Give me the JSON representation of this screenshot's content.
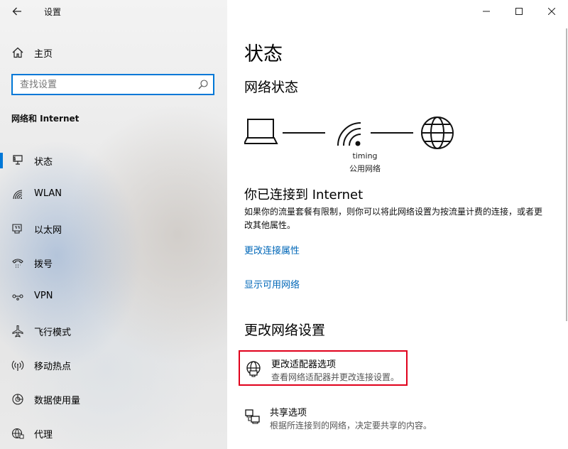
{
  "window": {
    "app_title": "设置",
    "controls": {
      "minimize": "minimize-icon",
      "maximize": "maximize-icon",
      "close": "close-icon"
    }
  },
  "sidebar": {
    "home_label": "主页",
    "search_placeholder": "查找设置",
    "section_title": "网络和 Internet",
    "items": [
      {
        "label": "状态",
        "icon": "status-icon",
        "active": true
      },
      {
        "label": "WLAN",
        "icon": "wlan-icon"
      },
      {
        "label": "以太网",
        "icon": "ethernet-icon"
      },
      {
        "label": "拨号",
        "icon": "dialup-icon"
      },
      {
        "label": "VPN",
        "icon": "vpn-icon"
      },
      {
        "label": "飞行模式",
        "icon": "airplane-icon"
      },
      {
        "label": "移动热点",
        "icon": "hotspot-icon"
      },
      {
        "label": "数据使用量",
        "icon": "data-usage-icon"
      },
      {
        "label": "代理",
        "icon": "proxy-icon"
      }
    ]
  },
  "main": {
    "title": "状态",
    "network_status_heading": "网络状态",
    "diagram": {
      "network_name": "timing",
      "network_type": "公用网络"
    },
    "connected_heading": "你已连接到 Internet",
    "connected_desc": "如果你的流量套餐有限制，则你可以将此网络设置为按流量计费的连接，或者更改其他属性。",
    "link_change_properties": "更改连接属性",
    "link_show_networks": "显示可用网络",
    "change_settings_heading": "更改网络设置",
    "options": [
      {
        "title": "更改适配器选项",
        "subtitle": "查看网络适配器并更改连接设置。",
        "icon": "adapter-globe-icon"
      },
      {
        "title": "共享选项",
        "subtitle": "根据所连接到的网络，决定要共享的内容。",
        "icon": "sharing-icon"
      }
    ]
  },
  "colors": {
    "accent": "#0078d7",
    "link": "#0067b8",
    "highlight_border": "#e0001b"
  }
}
